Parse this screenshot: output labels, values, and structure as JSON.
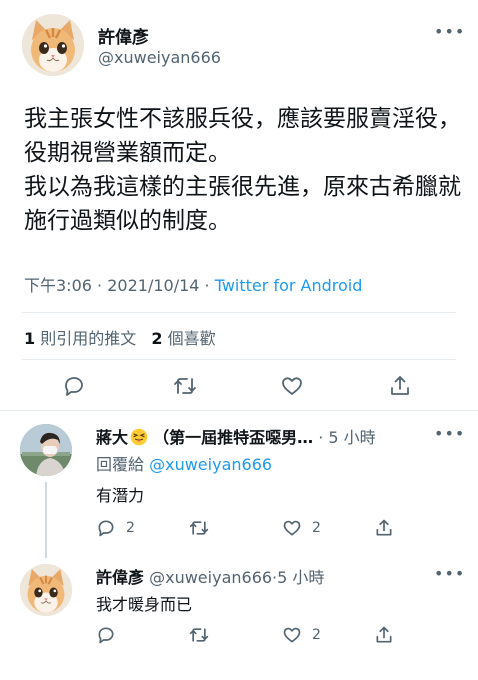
{
  "main_tweet": {
    "display_name": "許偉彥",
    "handle": "@xuweiyan666",
    "text_lines": [
      "我主張女性不該服兵役，應該要服賣淫役，役期視營業額而定。",
      "我以為我這樣的主張很先進，原來古希臘就施行過類似的制度。"
    ],
    "time": "下午3:06",
    "date": "2021/10/14",
    "separator": "·",
    "source": "Twitter for Android",
    "quote_count": "1",
    "quote_label": "則引用的推文",
    "like_count": "2",
    "like_label": "個喜歡"
  },
  "replies": [
    {
      "display_name": "蔣大",
      "name_suffix": "（第一屆推特盃噁男…",
      "separator": "·",
      "time": "5 小時",
      "reply_to_label": "回覆給",
      "reply_to_handle": "@xuweiyan666",
      "text": "有潛力",
      "reply_count": "2",
      "retweet_count": "",
      "like_count": "2"
    },
    {
      "display_name": "許偉彥",
      "handle": "@xuweiyan666",
      "separator": "·",
      "time": "5 小時",
      "text": "我才暖身而已",
      "reply_count": "",
      "retweet_count": "",
      "like_count": "2"
    }
  ],
  "icons": {
    "reply": "reply-icon",
    "retweet": "retweet-icon",
    "like": "heart-icon",
    "share": "share-icon",
    "more": "more-icon"
  },
  "colors": {
    "text": "#0f1419",
    "secondary": "#536471",
    "link": "#1d9bf0",
    "divider": "#e6ecf0"
  }
}
